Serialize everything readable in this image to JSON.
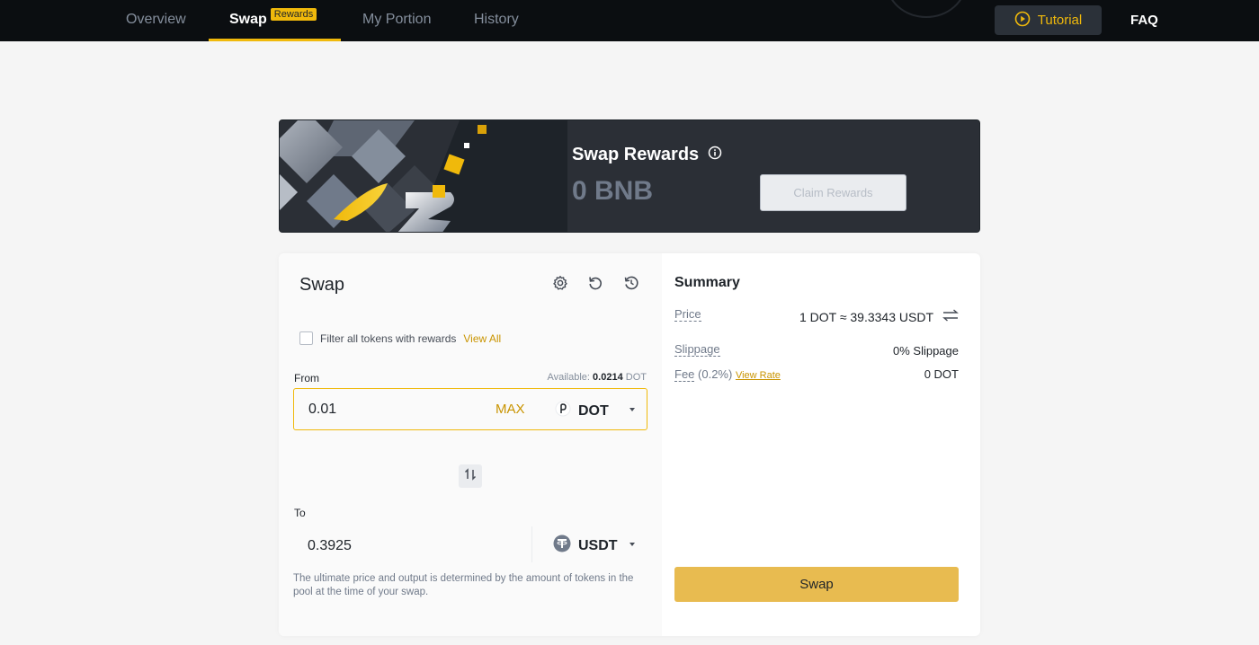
{
  "nav": {
    "items": [
      {
        "label": "Overview"
      },
      {
        "label": "Swap",
        "badge": "Rewards"
      },
      {
        "label": "My Portion"
      },
      {
        "label": "History"
      }
    ],
    "tutorial_label": "Tutorial",
    "faq_label": "FAQ",
    "accent_color": "#f0b90b"
  },
  "banner": {
    "title": "Swap Rewards",
    "amount": "0 BNB",
    "claim_label": "Claim Rewards"
  },
  "swap": {
    "title": "Swap",
    "icons": [
      "gear-icon",
      "refresh-icon",
      "history-icon"
    ],
    "filter_label": "Filter all tokens with rewards",
    "view_all_label": "View All",
    "from_label": "From",
    "available_prefix": "Available:",
    "available_amount": "0.0214",
    "available_unit": "DOT",
    "from_value": "0.01",
    "max_label": "MAX",
    "from_token": "DOT",
    "to_label": "To",
    "to_value": "0.3925",
    "to_token": "USDT",
    "note": "The ultimate price and output is determined by the amount of tokens in the pool at the time of your swap."
  },
  "summary": {
    "title": "Summary",
    "price_label": "Price",
    "price_value": "1 DOT ≈ 39.3343 USDT",
    "slippage_label": "Slippage",
    "slippage_value": "0% Slippage",
    "fee_label": "Fee",
    "fee_rate": "(0.2%)",
    "view_rate_label": "View Rate",
    "fee_value": "0 DOT",
    "swap_button": "Swap"
  }
}
